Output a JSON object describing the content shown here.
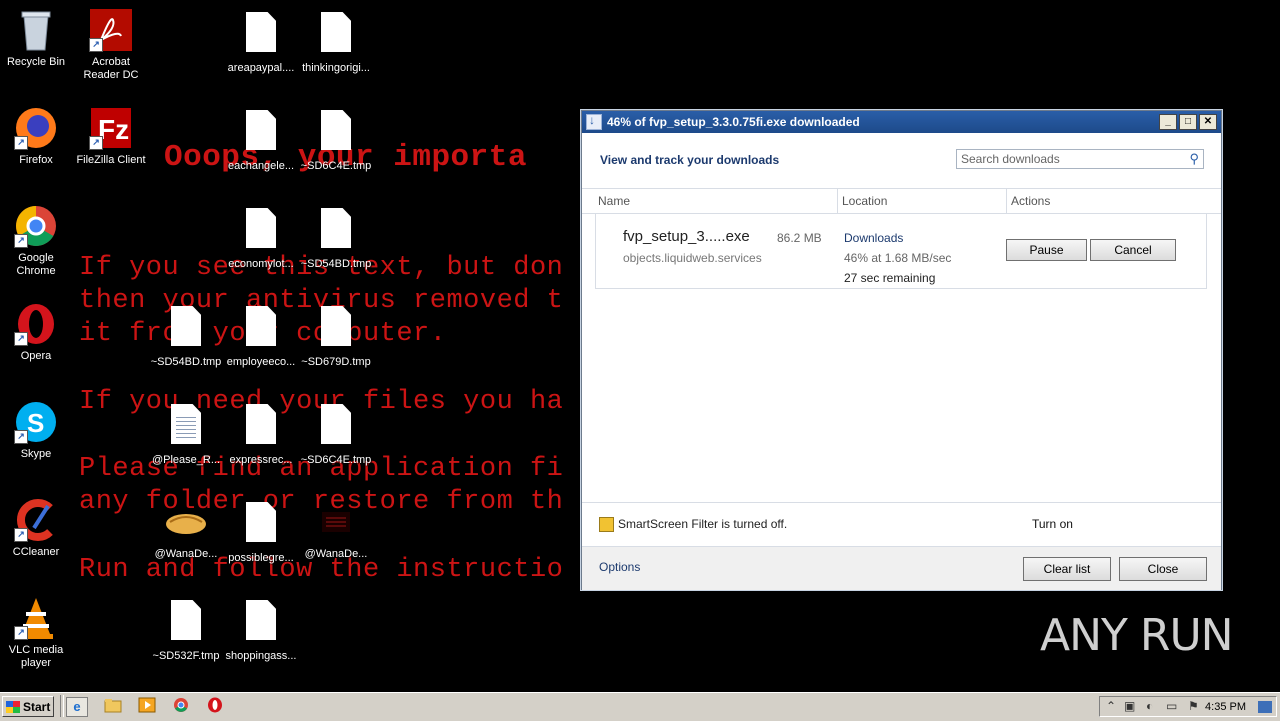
{
  "wallpaper": {
    "lines": [
      "Ooops, your importa",
      "If you see this text, but don",
      "then your antivirus removed t",
      "it from your computer.",
      "If you need your files you ha",
      "Please find an application fi",
      "any folder or restore from th",
      "Run and follow the instructio"
    ]
  },
  "desktop_icons": [
    {
      "label": "Recycle Bin",
      "icon": "recycle-bin-icon"
    },
    {
      "label": "Acrobat\nReader DC",
      "icon": "acrobat-icon"
    },
    {
      "label": "Firefox",
      "icon": "firefox-icon"
    },
    {
      "label": "FileZilla Client",
      "icon": "filezilla-icon"
    },
    {
      "label": "Google\nChrome",
      "icon": "chrome-icon"
    },
    {
      "label": "Opera",
      "icon": "opera-icon"
    },
    {
      "label": "Skype",
      "icon": "skype-icon"
    },
    {
      "label": "CCleaner",
      "icon": "ccleaner-icon"
    },
    {
      "label": "VLC media\nplayer",
      "icon": "vlc-icon"
    }
  ],
  "desktop_files": [
    "areapaypal....",
    "thinkingorigi...",
    "eachangele...",
    "~SD6C4E.tmp",
    "economylot...",
    "~SD54BD.tmp",
    "~SD54BD.tmp",
    "employeeco...",
    "~SD679D.tmp",
    "@Please_R...",
    "expressrec...",
    "~SD6C4E.tmp",
    "@WanaDe...",
    "possiblegre...",
    "@WanaDe...",
    "~SD532F.tmp",
    "shoppingass..."
  ],
  "window": {
    "title": "46% of fvp_setup_3.3.0.75fi.exe downloaded",
    "header_title": "View and track your downloads",
    "search_placeholder": "Search downloads",
    "columns": {
      "name": "Name",
      "location": "Location",
      "actions": "Actions"
    },
    "download": {
      "filename": "fvp_setup_3.....exe",
      "size": "86.2 MB",
      "source": "objects.liquidweb.services",
      "location": "Downloads",
      "progress": "46% at 1.68 MB/sec",
      "progress_fraction": 0.46,
      "remaining": "27 sec remaining",
      "pause_label": "Pause",
      "cancel_label": "Cancel"
    },
    "smartscreen": {
      "text": "SmartScreen Filter is turned off.",
      "action": "Turn on"
    },
    "footer": {
      "options": "Options",
      "clear_list": "Clear list",
      "close": "Close"
    }
  },
  "taskbar": {
    "start_label": "Start",
    "clock": "4:35 PM"
  },
  "watermark": "ANY RUN"
}
